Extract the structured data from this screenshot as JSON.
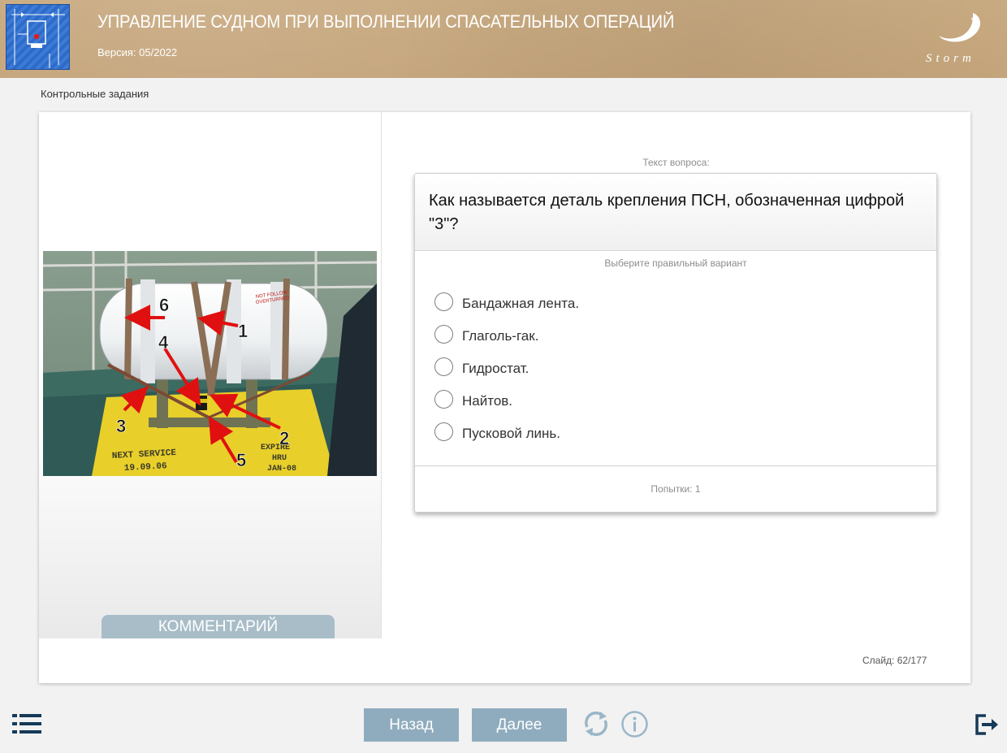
{
  "header": {
    "title": "УПРАВЛЕНИЕ СУДНОМ ПРИ ВЫПОЛНЕНИИ СПАСАТЕЛЬНЫХ ОПЕРАЦИЙ",
    "version": "Версия: 05/2022",
    "brand": "Storm",
    "logo_icon": "course-logo-icon"
  },
  "breadcrumb": "Контрольные задания",
  "image": {
    "callouts": [
      "1",
      "2",
      "3",
      "4",
      "5",
      "6"
    ],
    "stencil_left": [
      "NEXT SERVICE",
      "19.09.06"
    ],
    "stencil_right": [
      "EXPIRE",
      "HRU",
      "JAN-08"
    ],
    "raft_label": [
      "NOT FOLLOW",
      "OVERTURNED"
    ]
  },
  "comment_button": "КОММЕНТАРИЙ",
  "question": {
    "caption": "Текст вопроса:",
    "text": "Как называется деталь крепления ПСН, обозначенная цифрой \"3\"?",
    "hint": "Выберите правильный вариант",
    "options": [
      {
        "label": "Бандажная лента.",
        "selected": false
      },
      {
        "label": "Глаголь-гак.",
        "selected": false
      },
      {
        "label": "Гидростат.",
        "selected": false
      },
      {
        "label": "Найтов.",
        "selected": false
      },
      {
        "label": "Пусковой линь.",
        "selected": false
      }
    ],
    "attempts": "Попытки: 1"
  },
  "slide_counter": "Слайд: 62/177",
  "nav": {
    "back": "Назад",
    "next": "Далее",
    "icons": [
      "menu-list-icon",
      "reload-icon",
      "info-icon",
      "exit-icon"
    ]
  },
  "colors": {
    "header_bg": "#c6a77e",
    "button_bg": "#8facbe",
    "comment_bg": "#a8bdc8",
    "icon_dark": "#163a57",
    "icon_light": "#9ab6c8",
    "callout_arrow": "#e01010"
  }
}
